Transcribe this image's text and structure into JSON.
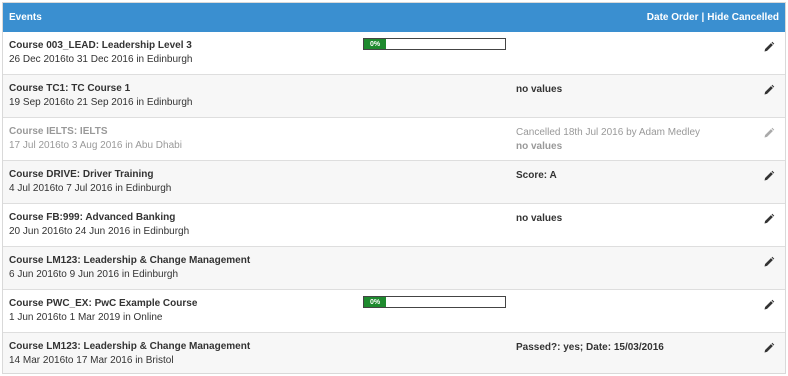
{
  "header": {
    "title": "Events",
    "date_order_label": "Date Order",
    "separator": "|",
    "hide_cancelled_label": "Hide Cancelled",
    "bar_color": "#3a8fd0"
  },
  "events": [
    {
      "title": "Course 003_LEAD: Leadership Level 3",
      "dates": "26 Dec 2016to 31 Dec 2016 in Edinburgh",
      "progress_label": "0%",
      "progress_value": 0
    },
    {
      "title": "Course TC1: TC Course 1",
      "dates": "19 Sep 2016to 21 Sep 2016 in Edinburgh",
      "info": "no values"
    },
    {
      "title": "Course IELTS: IELTS",
      "dates": "17 Jul 2016to 3 Aug 2016 in Abu Dhabi",
      "cancel_note": "Cancelled 18th Jul 2016 by Adam Medley",
      "info": "no values",
      "cancelled": true
    },
    {
      "title": "Course DRIVE: Driver Training",
      "dates": "4 Jul 2016to 7 Jul 2016 in Edinburgh",
      "info": "Score: A"
    },
    {
      "title": "Course FB:999: Advanced Banking",
      "dates": "20 Jun 2016to 24 Jun 2016 in Edinburgh",
      "info": "no values"
    },
    {
      "title": "Course LM123: Leadership & Change Management",
      "dates": "6 Jun 2016to 9 Jun 2016 in Edinburgh"
    },
    {
      "title": "Course PWC_EX: PwC Example Course",
      "dates": "1 Jun 2016to 1 Mar 2019 in Online",
      "progress_label": "0%",
      "progress_value": 0
    },
    {
      "title": "Course LM123: Leadership & Change Management",
      "dates": "14 Mar 2016to 17 Mar 2016 in Bristol",
      "info": "Passed?: yes; Date: 15/03/2016"
    }
  ],
  "icons": {
    "edit": "pencil-icon"
  },
  "colors": {
    "progress_fill": "#1e8a2e",
    "cancelled_text": "#999999"
  }
}
